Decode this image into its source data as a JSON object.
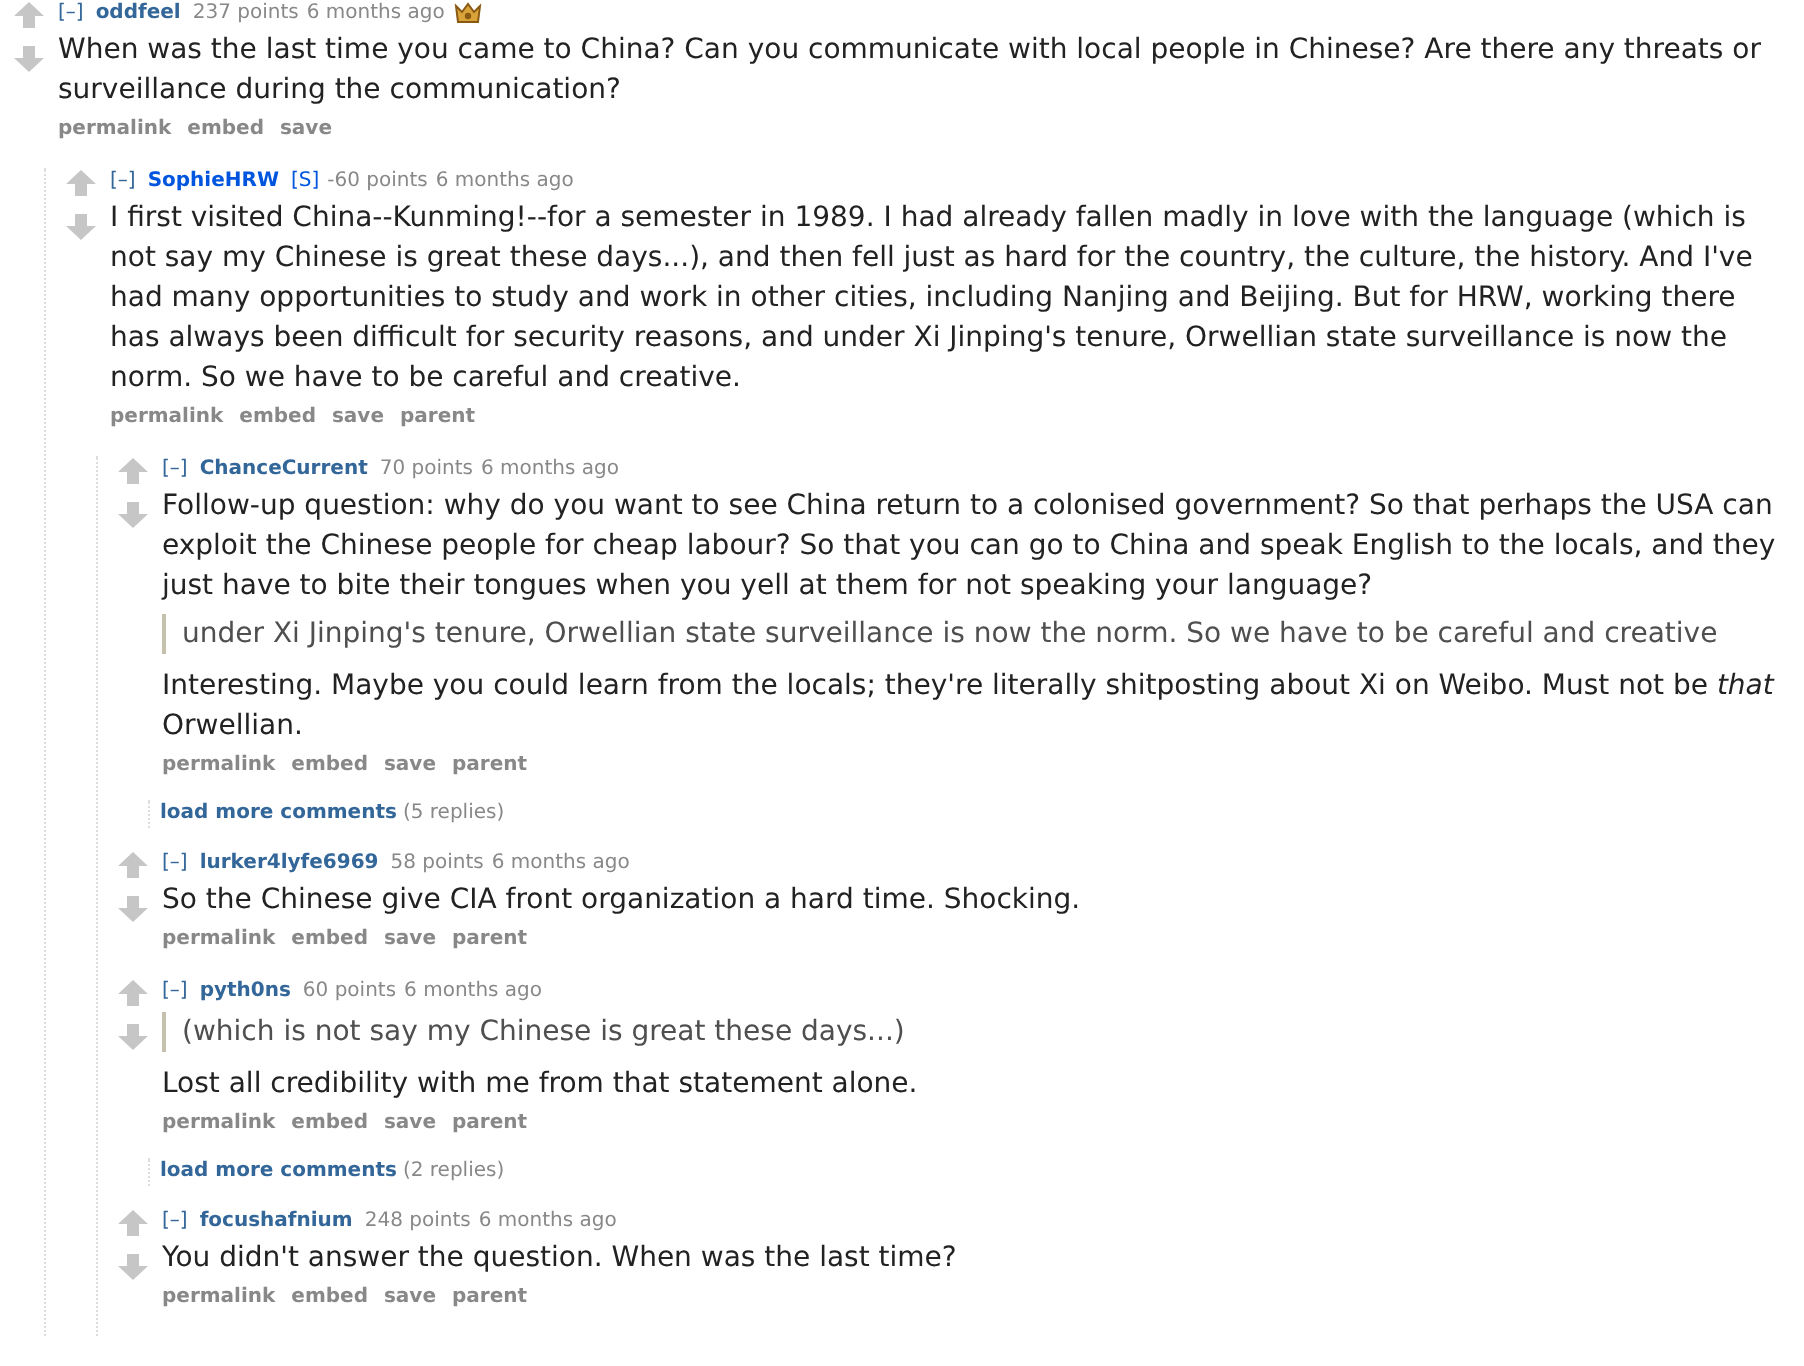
{
  "comments": [
    {
      "toggle": "[–]",
      "author": "oddfeel",
      "submitter": false,
      "score": "237 points",
      "time": "6 months ago",
      "award": true,
      "body": [
        {
          "kind": "text",
          "text": "When was the last time you came to China? Can you communicate with local people in Chinese? Are there any threats or surveillance during the communication?"
        }
      ],
      "actions": [
        "permalink",
        "embed",
        "save"
      ],
      "children": [
        {
          "toggle": "[–]",
          "author": "SophieHRW",
          "submitter": true,
          "tag": "[S]",
          "score": "-60 points",
          "time": "6 months ago",
          "award": false,
          "body": [
            {
              "kind": "text",
              "text": "I first visited China--Kunming!--for a semester in 1989. I had already fallen madly in love with the language (which is not say my Chinese is great these days...), and then fell just as hard for the country, the culture, the history. And I've had many opportunities to study and work in other cities, including Nanjing and Beijing. But for HRW, working there has always been difficult for security reasons, and under Xi Jinping's tenure, Orwellian state surveillance is now the norm. So we have to be careful and creative."
            }
          ],
          "actions": [
            "permalink",
            "embed",
            "save",
            "parent"
          ],
          "children": [
            {
              "toggle": "[–]",
              "author": "ChanceCurrent",
              "submitter": false,
              "score": "70 points",
              "time": "6 months ago",
              "award": false,
              "body": [
                {
                  "kind": "text",
                  "text": "Follow-up question: why do you want to see China return to a colonised government? So that perhaps the USA can exploit the Chinese people for cheap labour? So that you can go to China and speak English to the locals, and they just have to bite their tongues when you yell at them for not speaking your language?"
                },
                {
                  "kind": "quote",
                  "text": "under Xi Jinping's tenure, Orwellian state surveillance is now the norm. So we have to be careful and creative"
                },
                {
                  "kind": "text",
                  "text": "Interesting. Maybe you could learn from the locals; they're literally shitposting about Xi on Weibo. Must not be *that* Orwellian."
                }
              ],
              "actions": [
                "permalink",
                "embed",
                "save",
                "parent"
              ],
              "more": {
                "label": "load more comments",
                "count": "(5 replies)"
              }
            },
            {
              "toggle": "[–]",
              "author": "lurker4lyfe6969",
              "submitter": false,
              "score": "58 points",
              "time": "6 months ago",
              "award": false,
              "body": [
                {
                  "kind": "text",
                  "text": "So the Chinese give CIA front organization a hard time. Shocking."
                }
              ],
              "actions": [
                "permalink",
                "embed",
                "save",
                "parent"
              ]
            },
            {
              "toggle": "[–]",
              "author": "pyth0ns",
              "submitter": false,
              "score": "60 points",
              "time": "6 months ago",
              "award": false,
              "body": [
                {
                  "kind": "quote",
                  "text": "(which is not say my Chinese is great these days...)"
                },
                {
                  "kind": "text",
                  "text": "Lost all credibility with me from that statement alone."
                }
              ],
              "actions": [
                "permalink",
                "embed",
                "save",
                "parent"
              ],
              "more": {
                "label": "load more comments",
                "count": "(2 replies)"
              }
            },
            {
              "toggle": "[–]",
              "author": "focushafnium",
              "submitter": false,
              "score": "248 points",
              "time": "6 months ago",
              "award": false,
              "body": [
                {
                  "kind": "text",
                  "text": "You didn't answer the question. When was the last time?"
                }
              ],
              "actions": [
                "permalink",
                "embed",
                "save",
                "parent"
              ]
            }
          ]
        }
      ]
    }
  ]
}
